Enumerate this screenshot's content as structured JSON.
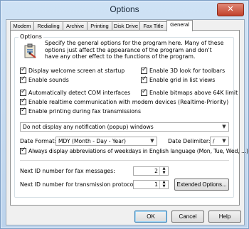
{
  "window": {
    "title": "Options",
    "close_glyph": "✕"
  },
  "tabs": [
    {
      "label": "Modem"
    },
    {
      "label": "Redialing"
    },
    {
      "label": "Archive"
    },
    {
      "label": "Printing"
    },
    {
      "label": "Disk Drive"
    },
    {
      "label": "Fax Title"
    },
    {
      "label": "General"
    }
  ],
  "active_tab": "General",
  "options": {
    "group_label": "Options",
    "icon": "clipboard-settings-icon",
    "description": "Specify the general options for the program here. Many of these options just affect the appearance of the program and don't have any other effect to the functions of the program.",
    "checkboxes": {
      "welcome": {
        "label": "Display welcome screen at startup",
        "checked": true
      },
      "sounds": {
        "label": "Enable sounds",
        "checked": true
      },
      "look3d": {
        "label": "Enable 3D look for toolbars",
        "checked": true
      },
      "grid": {
        "label": "Enable grid in list views",
        "checked": true
      },
      "com": {
        "label": "Automatically detect COM interfaces",
        "checked": true
      },
      "bitmaps": {
        "label": "Enable bitmaps above 64K limit",
        "checked": true
      },
      "realtime": {
        "label": "Enable realtime communication with modem devices (Realtime-Priority)",
        "checked": true
      },
      "printing": {
        "label": "Enable printing during fax transmissions",
        "checked": true
      },
      "abbrev": {
        "label": "Always display abbreviations of weekdays in English language (Mon, Tue, Wed, ...)",
        "checked": true
      }
    },
    "notification_select": "Do not display any notification (popup) windows",
    "date_format_label": "Date Format:",
    "date_format_value": "MDY (Month - Day - Year)",
    "date_delimiter_label": "Date Delimiter:",
    "date_delimiter_value": "/",
    "next_fax_label": "Next ID number for fax messages:",
    "next_fax_value": "2",
    "next_protocol_label": "Next ID number for transmission protocol:",
    "next_protocol_value": "1",
    "extended_button": "Extended Options..."
  },
  "footer": {
    "ok": "OK",
    "cancel": "Cancel",
    "help": "Help"
  }
}
